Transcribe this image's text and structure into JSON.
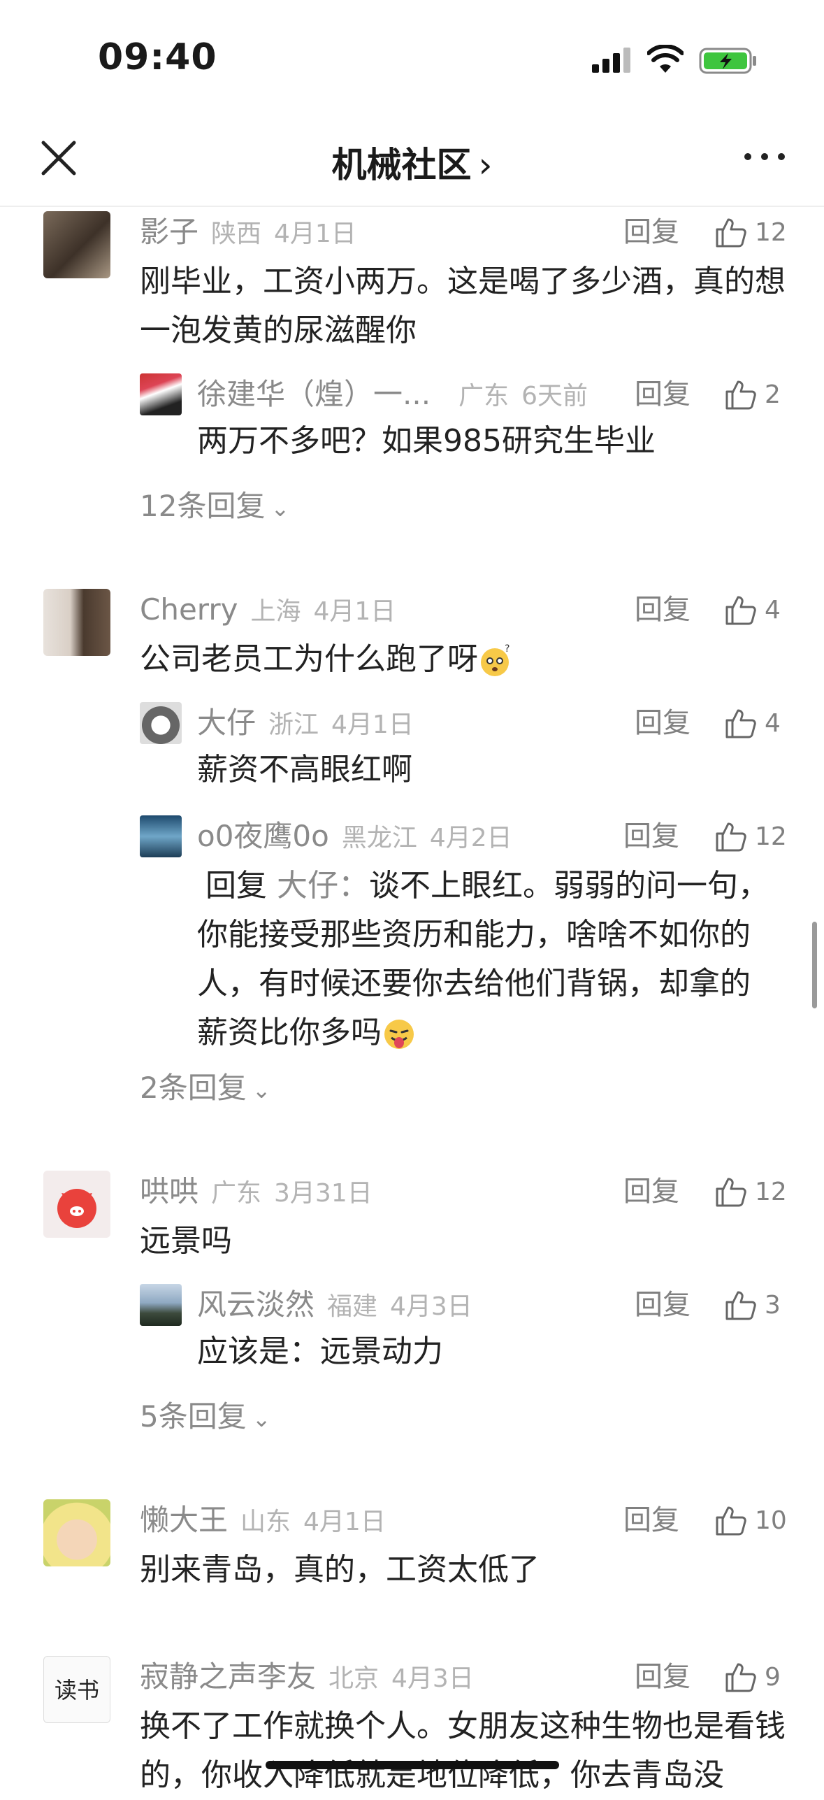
{
  "status_bar": {
    "time": "09:40"
  },
  "nav": {
    "title": "机械社区",
    "chevron": "›"
  },
  "comments": [
    {
      "name": "影子",
      "location": "陕西",
      "date": "4月1日",
      "reply_label": "回复",
      "likes": "12",
      "text": "刚毕业，工资小两万。这是喝了多少酒，真的想一泡发黄的尿滋醒你",
      "replies": [
        {
          "name": "徐建华（煌）一...",
          "location": "广东",
          "date": "6天前",
          "reply_label": "回复",
          "likes": "2",
          "text": "两万不多吧？如果985研究生毕业"
        }
      ],
      "expand": "12条回复"
    },
    {
      "name": "Cherry",
      "location": "上海",
      "date": "4月1日",
      "reply_label": "回复",
      "likes": "4",
      "text": "公司老员工为什么跑了呀",
      "replies": [
        {
          "name": "大仔",
          "location": "浙江",
          "date": "4月1日",
          "reply_label": "回复",
          "likes": "4",
          "text": "薪资不高眼红啊"
        },
        {
          "name": "o0夜鹰0o",
          "location": "黑龙江",
          "date": "4月2日",
          "reply_label": "回复",
          "likes": "12",
          "reply_prefix": "回复 ",
          "reply_to": "大仔：",
          "text": "谈不上眼红。弱弱的问一句，你能接受那些资历和能力，啥啥不如你的人，有时候还要你去给他们背锅，却拿的薪资比你多吗"
        }
      ],
      "expand": "2条回复"
    },
    {
      "name": "哄哄",
      "location": "广东",
      "date": "3月31日",
      "reply_label": "回复",
      "likes": "12",
      "text": "远景吗",
      "replies": [
        {
          "name": "风云淡然",
          "location": "福建",
          "date": "4月3日",
          "reply_label": "回复",
          "likes": "3",
          "text": "应该是：远景动力"
        }
      ],
      "expand": "5条回复"
    },
    {
      "name": "懒大王",
      "location": "山东",
      "date": "4月1日",
      "reply_label": "回复",
      "likes": "10",
      "text": "别来青岛，真的，工资太低了",
      "replies": []
    },
    {
      "name": "寂静之声李友",
      "location": "北京",
      "date": "4月3日",
      "reply_label": "回复",
      "likes": "9",
      "text": "换不了工作就换个人。女朋友这种生物也是看钱的，你收入降低就是地位降低，你去青岛没",
      "avatar_text": "读书",
      "replies": []
    }
  ],
  "colors": {
    "meta_gray": "#8a8a8a",
    "light_gray": "#b3b3b3",
    "text": "#222222"
  }
}
